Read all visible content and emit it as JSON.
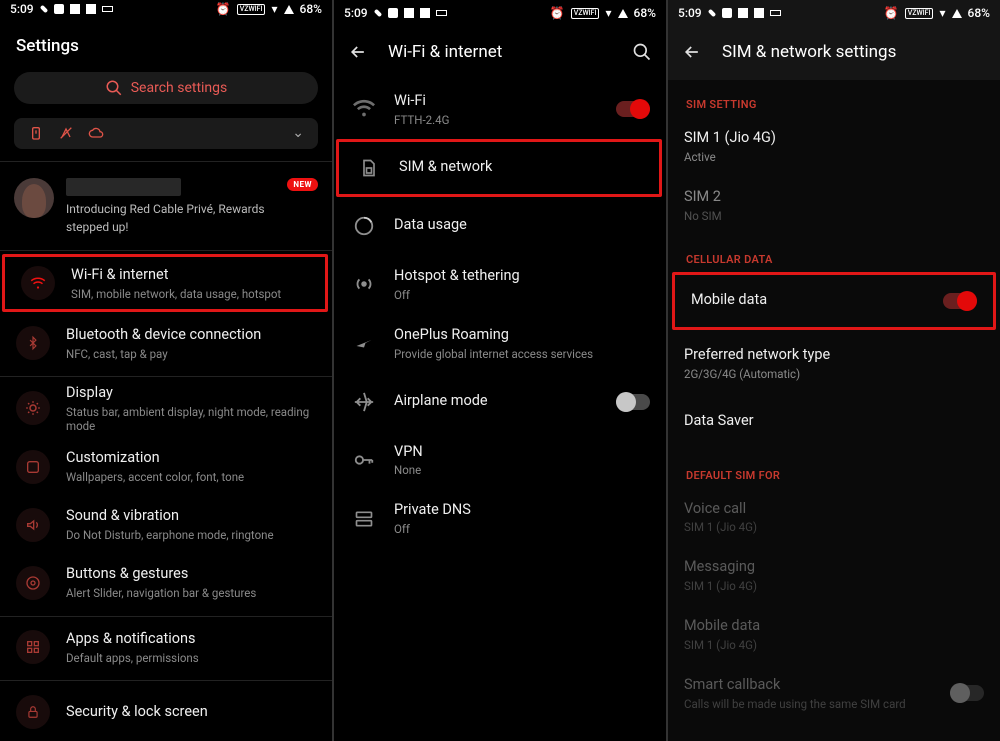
{
  "status": {
    "time": "5:09",
    "vzwifi": "VZWIFI",
    "battery": "68%"
  },
  "p1": {
    "title": "Settings",
    "search_placeholder": "Search settings",
    "profile": {
      "line1": "Introducing Red Cable Privé, Rewards",
      "line2": "stepped up!",
      "badge": "NEW"
    },
    "items": [
      {
        "title": "Wi-Fi & internet",
        "sub": "SIM, mobile network, data usage, hotspot"
      },
      {
        "title": "Bluetooth & device connection",
        "sub": "NFC, cast, tap & pay"
      },
      {
        "title": "Display",
        "sub": "Status bar, ambient display, night mode, reading mode"
      },
      {
        "title": "Customization",
        "sub": "Wallpapers, accent color, font, tone"
      },
      {
        "title": "Sound & vibration",
        "sub": "Do Not Disturb, earphone mode, ringtone"
      },
      {
        "title": "Buttons & gestures",
        "sub": "Alert Slider, navigation bar & gestures"
      },
      {
        "title": "Apps & notifications",
        "sub": "Default apps, permissions"
      },
      {
        "title": "Security & lock screen",
        "sub": ""
      }
    ]
  },
  "p2": {
    "title": "Wi-Fi & internet",
    "items": [
      {
        "title": "Wi-Fi",
        "sub": "FTTH-2.4G",
        "toggle": "on"
      },
      {
        "title": "SIM & network",
        "sub": ""
      },
      {
        "title": "Data usage",
        "sub": ""
      },
      {
        "title": "Hotspot & tethering",
        "sub": "Off"
      },
      {
        "title": "OnePlus Roaming",
        "sub": "Provide global internet access services"
      },
      {
        "title": "Airplane mode",
        "sub": "",
        "toggle": "off"
      },
      {
        "title": "VPN",
        "sub": "None"
      },
      {
        "title": "Private DNS",
        "sub": "Off"
      }
    ]
  },
  "p3": {
    "title": "SIM & network settings",
    "sec1": "SIM SETTING",
    "sim1": {
      "title": "SIM 1  (Jio 4G)",
      "sub": "Active"
    },
    "sim2": {
      "title": "SIM 2",
      "sub": "No SIM"
    },
    "sec2": "CELLULAR DATA",
    "mobile": "Mobile data",
    "pref": {
      "title": "Preferred network type",
      "sub": "2G/3G/4G (Automatic)"
    },
    "saver": "Data Saver",
    "sec3": "DEFAULT SIM FOR",
    "def": [
      {
        "title": "Voice call",
        "sub": "SIM 1  (Jio 4G)"
      },
      {
        "title": "Messaging",
        "sub": "SIM 1  (Jio 4G)"
      },
      {
        "title": "Mobile data",
        "sub": "SIM 1  (Jio 4G)"
      },
      {
        "title": "Smart callback",
        "sub": "Calls will be made using the same SIM card"
      }
    ]
  }
}
